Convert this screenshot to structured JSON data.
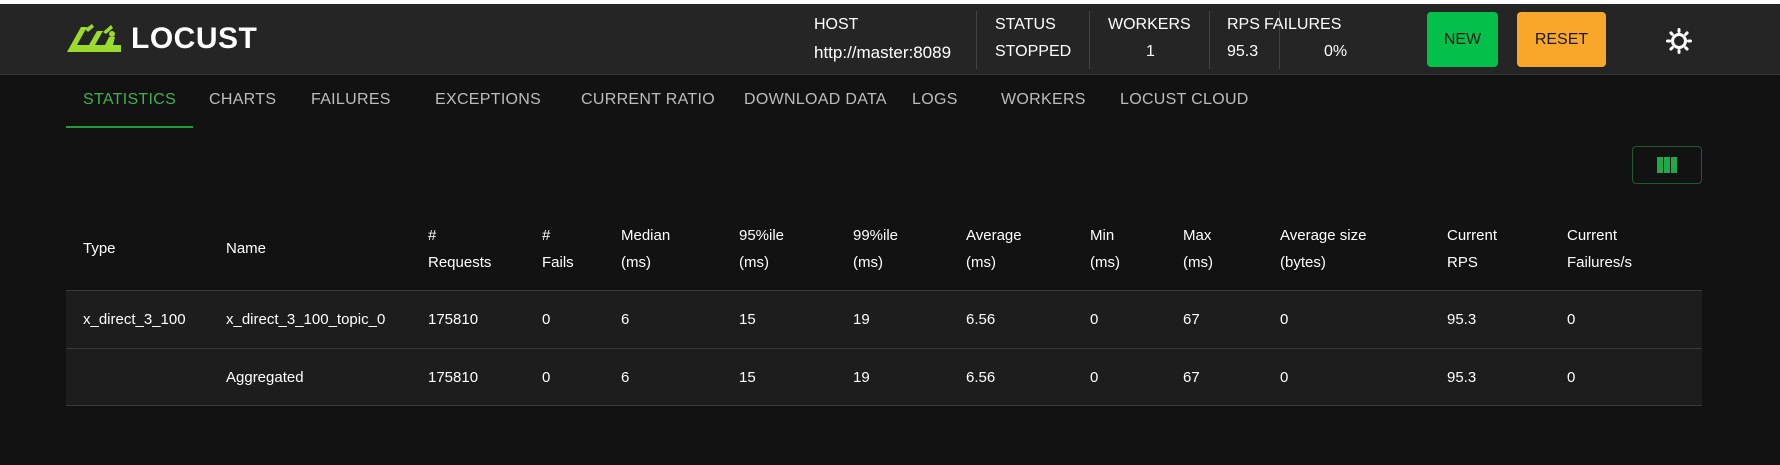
{
  "header": {
    "logo_text": "LOCUST",
    "stats": [
      {
        "label": "HOST",
        "value": "http://master:8089"
      },
      {
        "label": "STATUS",
        "value": "STOPPED"
      },
      {
        "label": "WORKERS",
        "value": "1"
      },
      {
        "label": "RPS",
        "value": "95.3"
      },
      {
        "label": "FAILURES",
        "value": "0%"
      }
    ],
    "new_label": "NEW",
    "reset_label": "RESET",
    "theme_icon": "sun-icon"
  },
  "tabs": [
    {
      "label": "STATISTICS",
      "active": true
    },
    {
      "label": "CHARTS",
      "active": false
    },
    {
      "label": "FAILURES",
      "active": false
    },
    {
      "label": "EXCEPTIONS",
      "active": false
    },
    {
      "label": "CURRENT RATIO",
      "active": false
    },
    {
      "label": "DOWNLOAD DATA",
      "active": false
    },
    {
      "label": "LOGS",
      "active": false
    },
    {
      "label": "WORKERS",
      "active": false
    },
    {
      "label": "LOCUST CLOUD",
      "active": false
    }
  ],
  "columns_button_icon": "columns-icon",
  "colors": {
    "accent_green": "#04c04a",
    "accent_orange": "#f9a72b",
    "active_tab": "#3fb24e"
  },
  "table": {
    "headers": [
      [
        "Type"
      ],
      [
        "Name"
      ],
      [
        "#",
        "Requests"
      ],
      [
        "#",
        "Fails"
      ],
      [
        "Median",
        "(ms)"
      ],
      [
        "95%ile",
        "(ms)"
      ],
      [
        "99%ile",
        "(ms)"
      ],
      [
        "Average",
        "(ms)"
      ],
      [
        "Min",
        "(ms)"
      ],
      [
        "Max",
        "(ms)"
      ],
      [
        "Average size",
        "(bytes)"
      ],
      [
        "Current",
        "RPS"
      ],
      [
        "Current",
        "Failures/s"
      ]
    ],
    "rows": [
      [
        "x_direct_3_100",
        "x_direct_3_100_topic_0",
        "175810",
        "0",
        "6",
        "15",
        "19",
        "6.56",
        "0",
        "67",
        "0",
        "95.3",
        "0"
      ],
      [
        "",
        "Aggregated",
        "175810",
        "0",
        "6",
        "15",
        "19",
        "6.56",
        "0",
        "67",
        "0",
        "95.3",
        "0"
      ]
    ]
  }
}
